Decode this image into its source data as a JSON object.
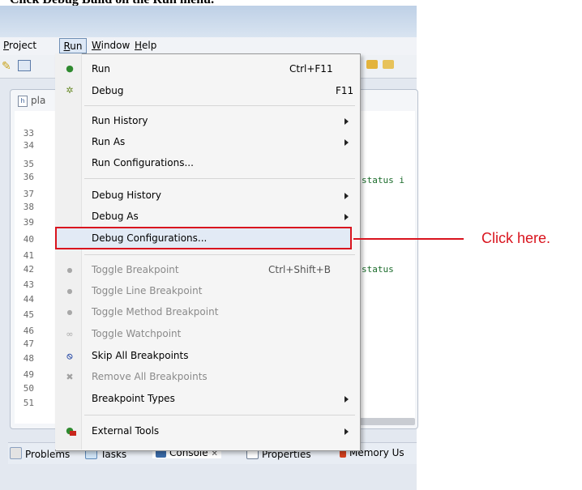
{
  "caption": "Click Debug Build on the Run menu.",
  "menubar": [
    {
      "label": "Project",
      "underline": "P"
    },
    {
      "label": "Run",
      "underline": "R"
    },
    {
      "label": "Window",
      "underline": "W"
    },
    {
      "label": "Help",
      "underline": "H"
    }
  ],
  "editor": {
    "tab_label": "pla",
    "line_numbers": [
      "33",
      "34",
      "35",
      "36",
      "37",
      "38",
      "39",
      "40",
      "41",
      "42",
      "43",
      "44",
      "45",
      "46",
      "47",
      "48",
      "49",
      "50",
      "51"
    ],
    "code_fragments": [
      "status i",
      "status"
    ]
  },
  "run_menu": {
    "run": {
      "label": "Run",
      "shortcut": "Ctrl+F11"
    },
    "debug": {
      "label": "Debug",
      "shortcut": "F11"
    },
    "run_history": "Run History",
    "run_as": "Run As",
    "run_configurations": "Run Configurations...",
    "debug_history": "Debug History",
    "debug_as": "Debug As",
    "debug_configurations": "Debug Configurations...",
    "toggle_breakpoint": {
      "label": "Toggle Breakpoint",
      "shortcut": "Ctrl+Shift+B"
    },
    "toggle_line_breakpoint": "Toggle Line Breakpoint",
    "toggle_method_breakpoint": "Toggle Method Breakpoint",
    "toggle_watchpoint": "Toggle Watchpoint",
    "skip_all_breakpoints": "Skip All Breakpoints",
    "remove_all_breakpoints": "Remove All Breakpoints",
    "breakpoint_types": "Breakpoint Types",
    "external_tools": "External Tools"
  },
  "bottom_tabs": {
    "problems": "Problems",
    "tasks": "Tasks",
    "console": "Console",
    "console_close": "✕",
    "properties": "Properties",
    "memory": "Memory Us"
  },
  "callout": "Click here.",
  "colors": {
    "highlight_border": "#d9141e",
    "callout": "#d9141e"
  }
}
